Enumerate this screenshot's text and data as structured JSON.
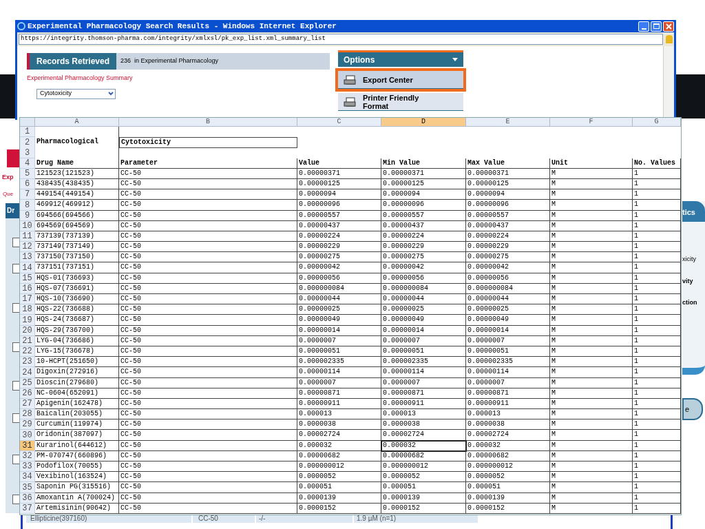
{
  "browser": {
    "title": "Experimental Pharmacology Search Results - Windows Internet Explorer",
    "url": "https://integrity.thomson-pharma.com/integrity/xmlxsl/pk_exp_list.xml_summary_list"
  },
  "page": {
    "records_label": "Records Retrieved",
    "records_count": "236  in Experimental Pharmacology",
    "summary_title": "Experimental Pharmacology Summary",
    "dropdown_value": "Cytotoxicity",
    "options_label": "Options",
    "menu": [
      {
        "label": "Export Center",
        "highlighted": true
      },
      {
        "label": "Printer Friendly Format",
        "highlighted": false
      }
    ]
  },
  "background_fragments": {
    "left": [
      "Exp",
      "Que",
      "Dr"
    ],
    "right_header": "tics",
    "right_items": [
      "xicity",
      "vity",
      "ction"
    ],
    "right_button": "e",
    "checkboxes": [
      {
        "checked": false
      },
      {
        "checked": false
      },
      {
        "checked": false
      },
      {
        "checked": false
      },
      {
        "checked": false
      },
      {
        "checked": false
      },
      {
        "checked": false
      },
      {
        "checked": false
      }
    ],
    "peek_row": [
      "Ellipticine(397160)",
      "CC-50",
      "-/-",
      "1.9 µM (n=1)"
    ]
  },
  "sheet": {
    "columns": [
      {
        "label": "A",
        "selected": false
      },
      {
        "label": "B",
        "selected": false
      },
      {
        "label": "C",
        "selected": false
      },
      {
        "label": "D",
        "selected": true
      },
      {
        "label": "E",
        "selected": false
      },
      {
        "label": "F",
        "selected": false
      },
      {
        "label": "G",
        "selected": false
      }
    ],
    "rows": [
      {
        "number": "1",
        "kind": "blank",
        "selected": false
      },
      {
        "number": "2",
        "kind": "title",
        "selected": false,
        "cells": [
          "Pharmacological",
          "Cytotoxicity"
        ]
      },
      {
        "number": "3",
        "kind": "blank",
        "selected": false
      },
      {
        "number": "4",
        "kind": "header",
        "selected": false,
        "cells": [
          "Drug Name",
          "Parameter",
          "Value",
          "Min Value",
          "Max Value",
          "Unit",
          "No. Values"
        ]
      },
      {
        "number": "5",
        "kind": "data",
        "selected": false,
        "cells": [
          "121523(121523)",
          "CC-50",
          "0.00000371",
          "0.00000371",
          "0.00000371",
          "M",
          "1"
        ]
      },
      {
        "number": "6",
        "kind": "data",
        "selected": false,
        "cells": [
          "438435(438435)",
          "CC-50",
          "0.00000125",
          "0.00000125",
          "0.00000125",
          "M",
          "1"
        ]
      },
      {
        "number": "7",
        "kind": "data",
        "selected": false,
        "cells": [
          "449154(449154)",
          "CC-50",
          "0.0000094",
          "0.0000094",
          "0.0000094",
          "M",
          "1"
        ]
      },
      {
        "number": "8",
        "kind": "data",
        "selected": false,
        "cells": [
          "469912(469912)",
          "CC-50",
          "0.00000096",
          "0.00000096",
          "0.00000096",
          "M",
          "1"
        ]
      },
      {
        "number": "9",
        "kind": "data",
        "selected": false,
        "cells": [
          "694566(694566)",
          "CC-50",
          "0.00000557",
          "0.00000557",
          "0.00000557",
          "M",
          "1"
        ]
      },
      {
        "number": "10",
        "kind": "data",
        "selected": false,
        "cells": [
          "694569(694569)",
          "CC-50",
          "0.00000437",
          "0.00000437",
          "0.00000437",
          "M",
          "1"
        ]
      },
      {
        "number": "11",
        "kind": "data",
        "selected": false,
        "cells": [
          "737139(737139)",
          "CC-50",
          "0.00000224",
          "0.00000224",
          "0.00000224",
          "M",
          "1"
        ]
      },
      {
        "number": "12",
        "kind": "data",
        "selected": false,
        "cells": [
          "737149(737149)",
          "CC-50",
          "0.00000229",
          "0.00000229",
          "0.00000229",
          "M",
          "1"
        ]
      },
      {
        "number": "13",
        "kind": "data",
        "selected": false,
        "cells": [
          "737150(737150)",
          "CC-50",
          "0.00000275",
          "0.00000275",
          "0.00000275",
          "M",
          "1"
        ]
      },
      {
        "number": "14",
        "kind": "data",
        "selected": false,
        "cells": [
          "737151(737151)",
          "CC-50",
          "0.00000042",
          "0.00000042",
          "0.00000042",
          "M",
          "1"
        ]
      },
      {
        "number": "15",
        "kind": "data",
        "selected": false,
        "cells": [
          "HQS-01(736693)",
          "CC-50",
          "0.00000056",
          "0.00000056",
          "0.00000056",
          "M",
          "1"
        ]
      },
      {
        "number": "16",
        "kind": "data",
        "selected": false,
        "cells": [
          "HQS-07(736691)",
          "CC-50",
          "0.000000084",
          "0.000000084",
          "0.000000084",
          "M",
          "1"
        ]
      },
      {
        "number": "17",
        "kind": "data",
        "selected": false,
        "cells": [
          "HQS-10(736690)",
          "CC-50",
          "0.00000044",
          "0.00000044",
          "0.00000044",
          "M",
          "1"
        ]
      },
      {
        "number": "18",
        "kind": "data",
        "selected": false,
        "cells": [
          "HQS-22(736688)",
          "CC-50",
          "0.00000025",
          "0.00000025",
          "0.00000025",
          "M",
          "1"
        ]
      },
      {
        "number": "19",
        "kind": "data",
        "selected": false,
        "cells": [
          "HQS-24(736687)",
          "CC-50",
          "0.00000049",
          "0.00000049",
          "0.00000049",
          "M",
          "1"
        ]
      },
      {
        "number": "20",
        "kind": "data",
        "selected": false,
        "cells": [
          "HQS-29(736700)",
          "CC-50",
          "0.00000014",
          "0.00000014",
          "0.00000014",
          "M",
          "1"
        ]
      },
      {
        "number": "21",
        "kind": "data",
        "selected": false,
        "cells": [
          "LYG-04(736686)",
          "CC-50",
          "0.0000007",
          "0.0000007",
          "0.0000007",
          "M",
          "1"
        ]
      },
      {
        "number": "22",
        "kind": "data",
        "selected": false,
        "cells": [
          "LYG-15(736678)",
          "CC-50",
          "0.00000051",
          "0.00000051",
          "0.00000051",
          "M",
          "1"
        ]
      },
      {
        "number": "23",
        "kind": "data",
        "selected": false,
        "cells": [
          "10-HCPT(251650)",
          "CC-50",
          "0.000002335",
          "0.000002335",
          "0.000002335",
          "M",
          "1"
        ]
      },
      {
        "number": "24",
        "kind": "data",
        "selected": false,
        "cells": [
          "Digoxin(272916)",
          "CC-50",
          "0.00000114",
          "0.00000114",
          "0.00000114",
          "M",
          "1"
        ]
      },
      {
        "number": "25",
        "kind": "data",
        "selected": false,
        "cells": [
          "Dioscin(279680)",
          "CC-50",
          "0.0000007",
          "0.0000007",
          "0.0000007",
          "M",
          "1"
        ]
      },
      {
        "number": "26",
        "kind": "data",
        "selected": false,
        "cells": [
          "NC-0604(652091)",
          "CC-50",
          "0.00000871",
          "0.00000871",
          "0.00000871",
          "M",
          "1"
        ]
      },
      {
        "number": "27",
        "kind": "data",
        "selected": false,
        "cells": [
          "Apigenin(162478)",
          "CC-50",
          "0.00000911",
          "0.00000911",
          "0.00000911",
          "M",
          "1"
        ]
      },
      {
        "number": "28",
        "kind": "data",
        "selected": false,
        "cells": [
          "Baicalin(203055)",
          "CC-50",
          "0.000013",
          "0.000013",
          "0.000013",
          "M",
          "1"
        ]
      },
      {
        "number": "29",
        "kind": "data",
        "selected": false,
        "cells": [
          "Curcumin(119974)",
          "CC-50",
          "0.0000038",
          "0.0000038",
          "0.0000038",
          "M",
          "1"
        ]
      },
      {
        "number": "30",
        "kind": "data",
        "selected": false,
        "cells": [
          "Oridonin(387097)",
          "CC-50",
          "0.00002724",
          "0.00002724",
          "0.00002724",
          "M",
          "1"
        ]
      },
      {
        "number": "31",
        "kind": "data",
        "selected": true,
        "cells": [
          "Kurarinol(644612)",
          "CC-50",
          "0.000032",
          "0.000032",
          "0.000032",
          "M",
          "1"
        ]
      },
      {
        "number": "32",
        "kind": "data",
        "selected": false,
        "cells": [
          "PM-070747(660896)",
          "CC-50",
          "0.00000682",
          "0.00000682",
          "0.00000682",
          "M",
          "1"
        ]
      },
      {
        "number": "33",
        "kind": "data",
        "selected": false,
        "cells": [
          "Podofilox(70055)",
          "CC-50",
          "0.000000012",
          "0.000000012",
          "0.000000012",
          "M",
          "1"
        ]
      },
      {
        "number": "34",
        "kind": "data",
        "selected": false,
        "cells": [
          "Vexibinol(163524)",
          "CC-50",
          "0.0000052",
          "0.0000052",
          "0.0000052",
          "M",
          "1"
        ]
      },
      {
        "number": "35",
        "kind": "data",
        "selected": false,
        "cells": [
          "Saponin PG(315516)",
          "CC-50",
          "0.000051",
          "0.000051",
          "0.000051",
          "M",
          "1"
        ]
      },
      {
        "number": "36",
        "kind": "data",
        "selected": false,
        "cells": [
          "Amoxantin A(700024)",
          "CC-50",
          "0.0000139",
          "0.0000139",
          "0.0000139",
          "M",
          "1"
        ]
      },
      {
        "number": "37",
        "kind": "data",
        "selected": false,
        "cells": [
          "Artemisinin(90642)",
          "CC-50",
          "0.0000152",
          "0.0000152",
          "0.0000152",
          "M",
          "1"
        ]
      }
    ]
  }
}
